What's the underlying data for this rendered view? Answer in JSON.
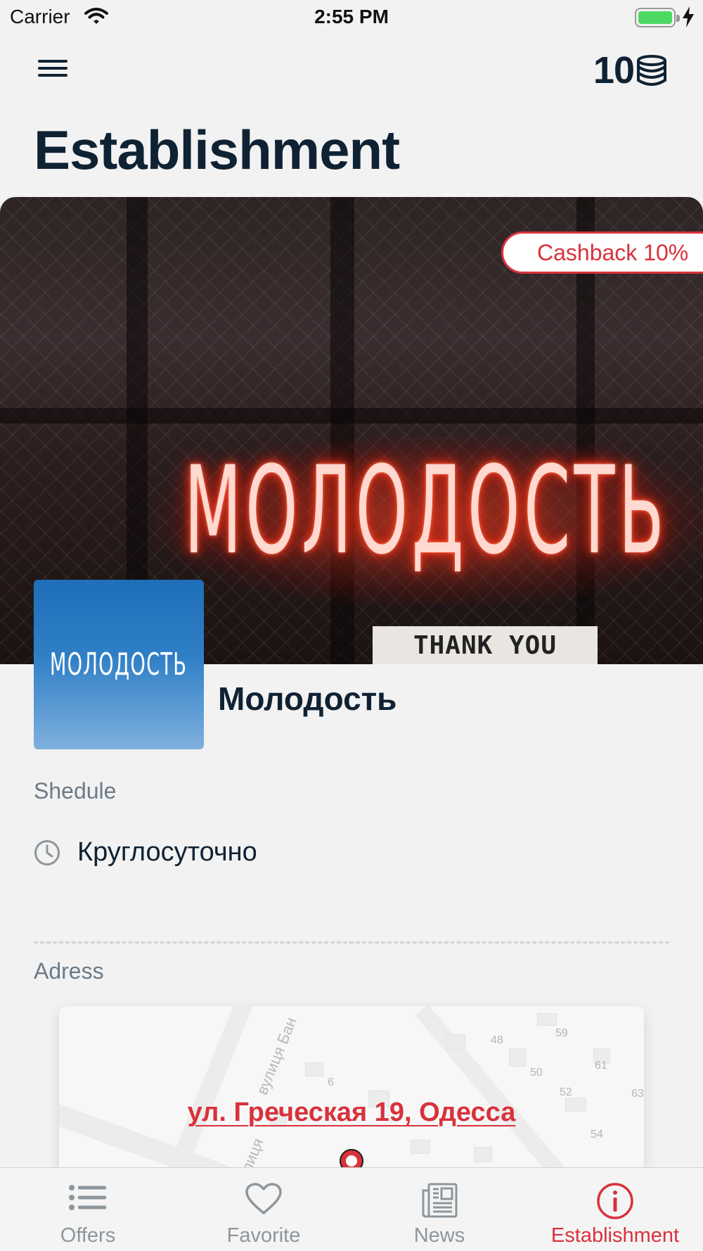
{
  "status_bar": {
    "carrier": "Carrier",
    "time": "2:55 PM"
  },
  "header": {
    "coins": "10",
    "menu_icon": "hamburger-menu-icon",
    "coins_icon": "coin-stack-icon"
  },
  "page": {
    "title": "Establishment"
  },
  "hero": {
    "cashback_badge": "Cashback 10%",
    "neon_sign_text": "МОЛОДОСТЬ",
    "sign_text": "THANK YOU MARIO!"
  },
  "venue": {
    "logo_text": "МОЛОДОСТЬ",
    "name": "Молодость"
  },
  "schedule": {
    "label": "Shedule",
    "value": "Круглосуточно",
    "icon": "clock-icon"
  },
  "address": {
    "label": "Adress",
    "value": "ул. Греческая 19, Одесса",
    "map_street_1": "вулиця Бан",
    "map_street_2": "улиця",
    "map_numbers": [
      "48",
      "59",
      "6",
      "50",
      "52",
      "61",
      "63",
      "54"
    ]
  },
  "tabs": [
    {
      "label": "Offers",
      "icon": "list-icon",
      "active": false
    },
    {
      "label": "Favorite",
      "icon": "heart-icon",
      "active": false
    },
    {
      "label": "News",
      "icon": "newspaper-icon",
      "active": false
    },
    {
      "label": "Establishment",
      "icon": "info-icon",
      "active": true
    }
  ],
  "colors": {
    "accent": "#d8323c",
    "text_dark": "#0f2233",
    "muted": "#6b7b89",
    "tab_inactive": "#8e969c",
    "background": "#f2f2f2"
  }
}
